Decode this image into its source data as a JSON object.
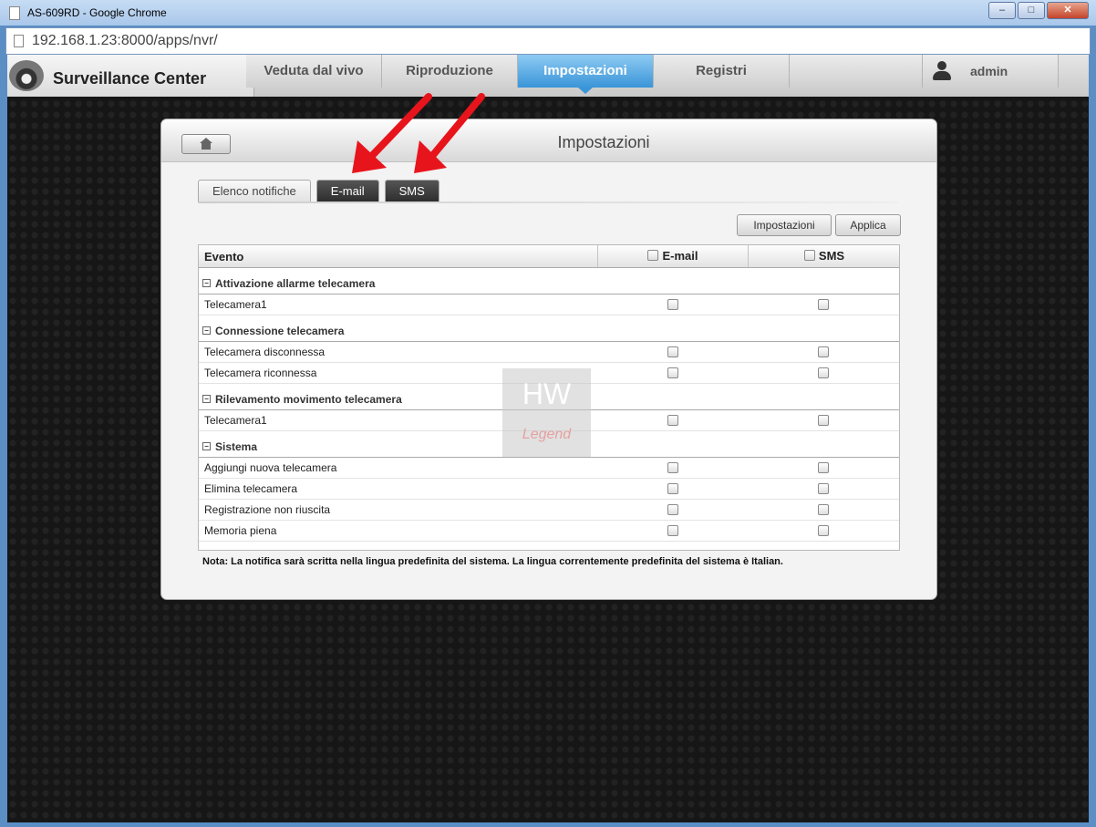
{
  "window": {
    "title": "AS-609RD - Google Chrome",
    "url": "192.168.1.23:8000/apps/nvr/"
  },
  "app": {
    "brand": "Surveillance Center",
    "nav": [
      "Veduta dal vivo",
      "Riproduzione",
      "Impostazioni",
      "Registri"
    ],
    "active_nav": "Impostazioni",
    "user": "admin"
  },
  "panel": {
    "title": "Impostazioni",
    "tabs": [
      "Elenco notifiche",
      "E-mail",
      "SMS"
    ],
    "buttons": {
      "settings": "Impostazioni",
      "apply": "Applica"
    },
    "columns": {
      "event": "Evento",
      "email": "E-mail",
      "sms": "SMS"
    },
    "groups": [
      {
        "name": "Attivazione allarme telecamera",
        "rows": [
          "Telecamera1"
        ]
      },
      {
        "name": "Connessione telecamera",
        "rows": [
          "Telecamera disconnessa",
          "Telecamera riconnessa"
        ]
      },
      {
        "name": "Rilevamento movimento telecamera",
        "rows": [
          "Telecamera1"
        ]
      },
      {
        "name": "Sistema",
        "rows": [
          "Aggiungi nuova telecamera",
          "Elimina telecamera",
          "Registrazione non riuscita",
          "Memoria piena"
        ]
      }
    ],
    "note": "Nota: La notifica sarà scritta nella lingua predefinita del sistema. La lingua correntemente predefinita del sistema è Italian."
  },
  "watermark": {
    "top": "HW",
    "bottom": "Legend"
  },
  "colors": {
    "accent": "#3a95d8",
    "arrow": "#e8141c",
    "background": "#161616"
  }
}
